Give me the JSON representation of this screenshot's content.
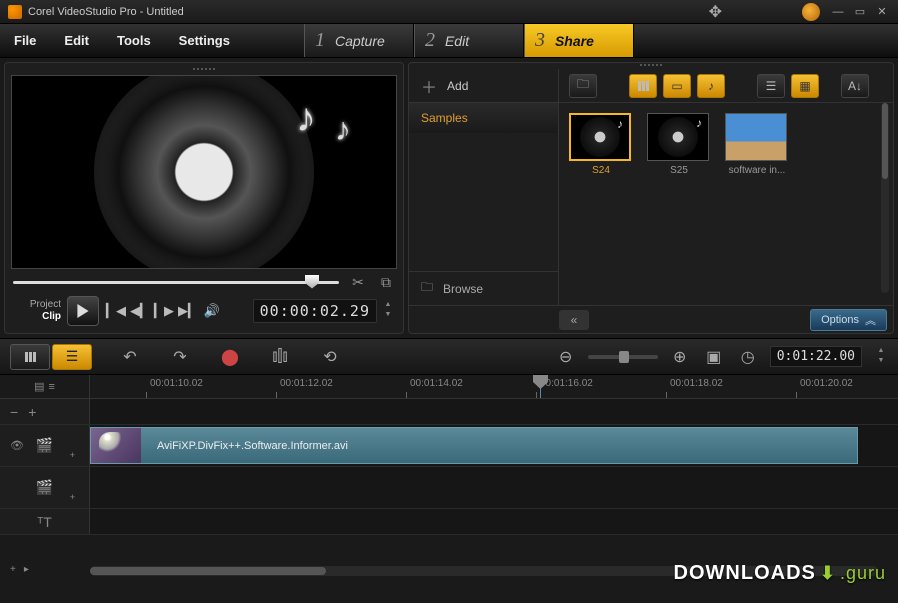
{
  "window": {
    "title": "Corel VideoStudio Pro - Untitled"
  },
  "menu": {
    "file": "File",
    "edit": "Edit",
    "tools": "Tools",
    "settings": "Settings"
  },
  "steps": {
    "s1": {
      "num": "1",
      "label": "Capture"
    },
    "s2": {
      "num": "2",
      "label": "Edit"
    },
    "s3": {
      "num": "3",
      "label": "Share"
    }
  },
  "preview": {
    "project_label": "Project",
    "clip_label": "Clip",
    "timecode": "00:00:02.29"
  },
  "library": {
    "add_label": "Add",
    "folder1": "Samples",
    "browse_label": "Browse",
    "options_label": "Options",
    "items": [
      {
        "label": "S24"
      },
      {
        "label": "S25"
      },
      {
        "label": "software in..."
      }
    ]
  },
  "timeline": {
    "total_time": "0:01:22.00",
    "ruler": [
      "00:01:10.02",
      "00:01:12.02",
      "00:01:14.02",
      "00:01:16.02",
      "00:01:18.02",
      "00:01:20.02"
    ],
    "clip_name": "AviFiXP.DivFix++.Software.Informer.avi"
  },
  "watermark": {
    "text": "DOWNLOADS",
    "suffix": ".guru"
  }
}
